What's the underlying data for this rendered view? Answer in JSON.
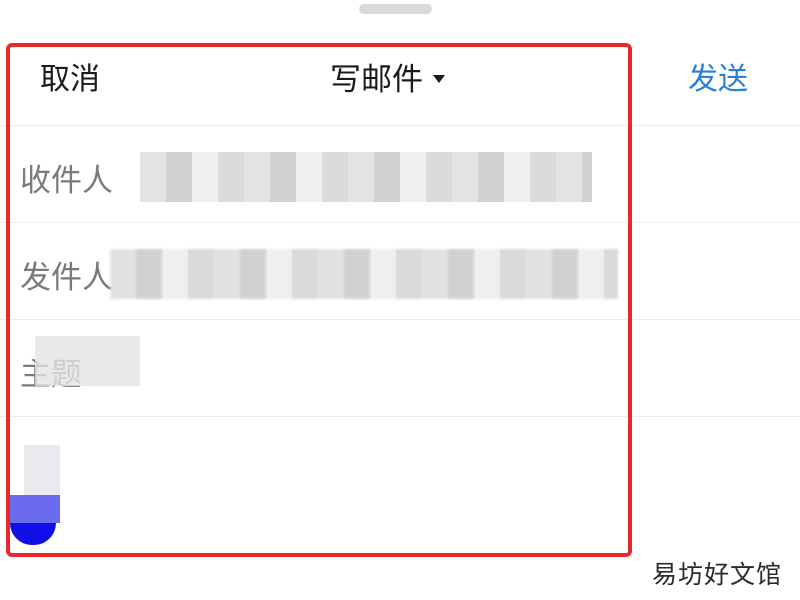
{
  "header": {
    "cancel_label": "取消",
    "title": "写邮件",
    "send_label": "发送"
  },
  "fields": {
    "to_label": "收件人",
    "from_label": "发件人",
    "subject_label": "主题"
  },
  "watermark": "易坊好文馆",
  "colors": {
    "accent": "#2a7fd6",
    "highlight_frame": "#e52a2a",
    "label_gray": "#7a7a7a"
  }
}
